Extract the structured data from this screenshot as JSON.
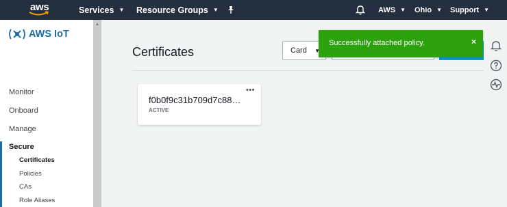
{
  "nav": {
    "logo": "aws",
    "services": "Services",
    "resource_groups": "Resource Groups",
    "account": "AWS",
    "region": "Ohio",
    "support": "Support",
    "pin_icon": "pin-icon",
    "bell_icon": "bell-icon"
  },
  "sidebar": {
    "brand": "AWS IoT",
    "items": [
      "Monitor",
      "Onboard",
      "Manage",
      "Secure"
    ],
    "sub_items": [
      "Certificates",
      "Policies",
      "CAs",
      "Role Aliases"
    ]
  },
  "main": {
    "title": "Certificates",
    "view_select": "Card"
  },
  "card": {
    "id": "f0b0f9c31b709d7c88…",
    "status": "ACTIVE",
    "menu": "•••"
  },
  "toast": {
    "message": "Successfully attached policy.",
    "close": "×"
  },
  "colors": {
    "nav_bg": "#232f3e",
    "toast_bg": "#2ea10e",
    "accent": "#1b6ea8",
    "button": "#00a1c9"
  }
}
